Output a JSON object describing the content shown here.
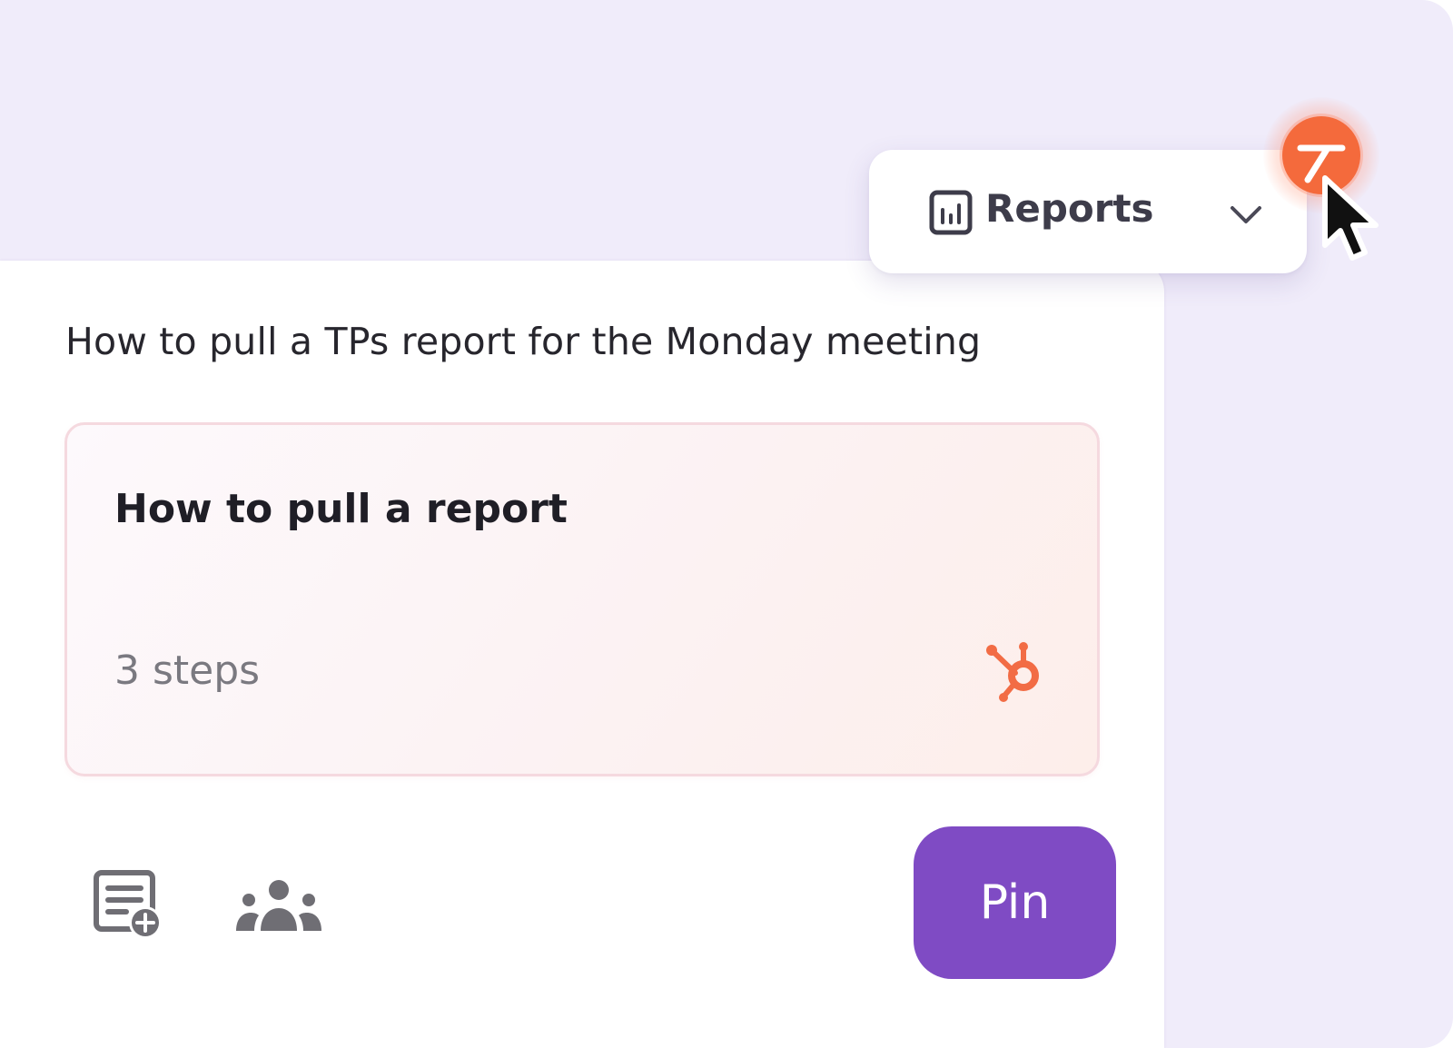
{
  "reports_select": {
    "label": "Reports",
    "icon": "bar-chart-box-icon"
  },
  "header": {
    "title": "How to pull a TPs report for the Monday meeting"
  },
  "guide_card": {
    "title": "How to pull a report",
    "steps": "3 steps",
    "integration_icon": "hubspot-icon"
  },
  "actions": {
    "add_doc_icon": "add-document-icon",
    "team_icon": "team-icon"
  },
  "pin_button": {
    "label": "Pin"
  },
  "colors": {
    "background": "#f0ecfa",
    "accent": "#7f4bc4",
    "brand_orange": "#f46a3c",
    "hubspot_orange": "#f26c45"
  }
}
